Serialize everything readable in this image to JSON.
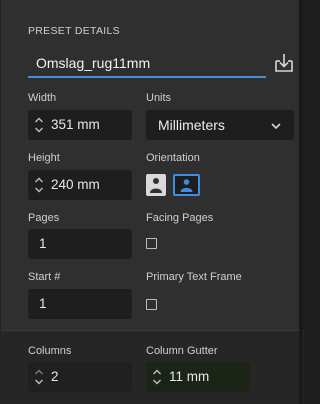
{
  "panel": {
    "section_title": "PRESET DETAILS",
    "preset_name": "Omslag_rug11mm",
    "save_icon": "save-preset-icon"
  },
  "width": {
    "label": "Width",
    "value": "351 mm"
  },
  "units": {
    "label": "Units",
    "selected": "Millimeters"
  },
  "height": {
    "label": "Height",
    "value": "240 mm"
  },
  "orientation": {
    "label": "Orientation",
    "selected": "landscape"
  },
  "pages": {
    "label": "Pages",
    "value": "1"
  },
  "facing_pages": {
    "label": "Facing Pages",
    "checked": false
  },
  "start": {
    "label": "Start #",
    "value": "1"
  },
  "primary_text_frame": {
    "label": "Primary Text Frame",
    "checked": false
  },
  "columns": {
    "label": "Columns",
    "value": "2"
  },
  "column_gutter": {
    "label": "Column Gutter",
    "value": "11 mm"
  },
  "colors": {
    "accent": "#3f8de0",
    "panel_bg": "#2f2f2f",
    "field_bg": "#1e1e1e"
  }
}
